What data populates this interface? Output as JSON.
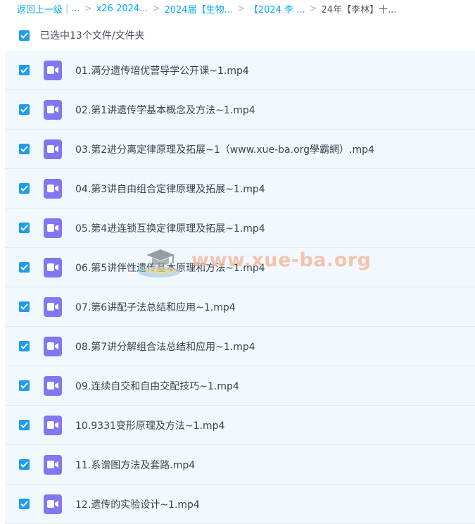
{
  "breadcrumb": {
    "back": "返回上一级",
    "bar": "|",
    "ellipsis": "...",
    "items": [
      "x26 2024...",
      "2024届【生物...",
      "【2024 李 ...",
      "24年【李林】十..."
    ]
  },
  "selection": {
    "label": "已选中13个文件/文件夹",
    "checked": true
  },
  "files": [
    {
      "name": "01.满分遗传培优营导学公开课~1.mp4",
      "checked": true
    },
    {
      "name": "02.第1讲遗传学基本概念及方法~1.mp4",
      "checked": true
    },
    {
      "name": "03.第2进分离定律原理及拓展~1（www.xue-ba.org學霸網）.mp4",
      "checked": true
    },
    {
      "name": "04.第3讲自由组合定律原理及拓展~1.mp4",
      "checked": true
    },
    {
      "name": "05.第4进连锁互换定律原理及拓展~1.mp4",
      "checked": true
    },
    {
      "name": "06.第5讲伴性遗传基本原理和方法~1.mp4",
      "checked": true
    },
    {
      "name": "07.第6讲配子法总结和应用~1.mp4",
      "checked": true
    },
    {
      "name": "08.第7讲分解组合法总结和应用~1.mp4",
      "checked": true
    },
    {
      "name": "09.连续自交和自由交配技巧~1.mp4",
      "checked": true
    },
    {
      "name": "10.9331变形原理及方法~1.mp4",
      "checked": true
    },
    {
      "name": "11.系谱图方法及套路.mp4",
      "checked": true
    },
    {
      "name": "12.遗传的实验设计~1.mp4",
      "checked": true
    }
  ],
  "watermark": {
    "text": "www.xue-ba.org"
  },
  "colors": {
    "accent": "#06a7ff",
    "checkbox": "#1e9cf0",
    "video_icon": "#8276f2",
    "row_bg": "#f1f9ff"
  }
}
